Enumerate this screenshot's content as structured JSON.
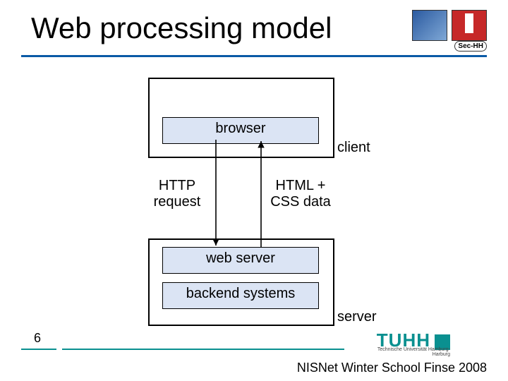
{
  "title": "Web processing model",
  "sec_badge": "Sec-HH",
  "client": {
    "browser": "browser",
    "label": "client"
  },
  "arrows": {
    "down": "HTTP request",
    "up": "HTML + CSS data"
  },
  "server": {
    "web_server": "web server",
    "backend": "backend systems",
    "label": "server"
  },
  "page_number": "6",
  "tuhh": {
    "brand": "TUHH",
    "sub": "Technische Universität Hamburg-Harburg"
  },
  "footer": "NISNet Winter School Finse 2008"
}
